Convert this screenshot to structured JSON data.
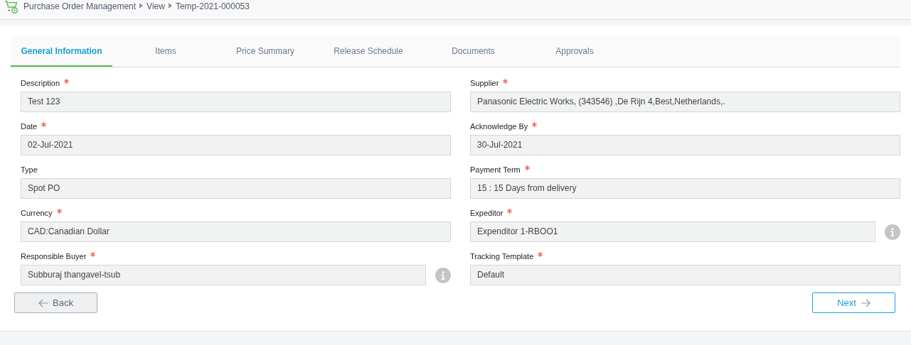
{
  "breadcrumb": [
    "Purchase Order Management",
    "View",
    "Temp-2021-000053"
  ],
  "tabs": [
    {
      "label": "General Information",
      "selected": true
    },
    {
      "label": "Items",
      "selected": false
    },
    {
      "label": "Price Summary",
      "selected": false
    },
    {
      "label": "Release Schedule",
      "selected": false
    },
    {
      "label": "Documents",
      "selected": false
    },
    {
      "label": "Approvals",
      "selected": false
    }
  ],
  "columns": [
    [
      {
        "label": "Description",
        "required": true,
        "value": "Test 123",
        "info": false
      },
      {
        "label": "Date",
        "required": true,
        "value": "02-Jul-2021",
        "info": false
      },
      {
        "label": "Type",
        "required": false,
        "value": "Spot PO",
        "info": false
      },
      {
        "label": "Currency",
        "required": true,
        "value": "CAD:Canadian Dollar",
        "info": false
      },
      {
        "label": "Responsible Buyer",
        "required": true,
        "value": "Subburaj thangavel-tsub",
        "info": true
      }
    ],
    [
      {
        "label": "Supplier",
        "required": true,
        "value": "Panasonic Electric Works, (343546) ,De Rijn 4,Best,Netherlands,.",
        "info": false
      },
      {
        "label": "Acknowledge By",
        "required": true,
        "value": "30-Jul-2021",
        "info": false
      },
      {
        "label": "Payment Term",
        "required": true,
        "value": "15 : 15 Days from delivery",
        "info": false
      },
      {
        "label": "Expeditor",
        "required": true,
        "value": "Expenditor 1-RBOO1",
        "info": true
      },
      {
        "label": "Tracking Template",
        "required": true,
        "value": "Default",
        "info": false
      }
    ]
  ],
  "back_button": "Back",
  "next_button": "Next"
}
